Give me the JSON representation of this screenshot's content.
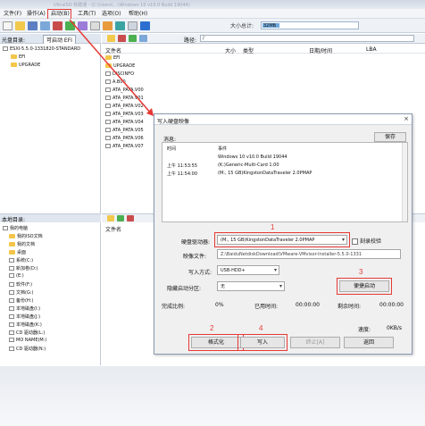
{
  "window": {
    "titlebar_text": "UltraISO 软碟通 - (C:\\Users\\...\\Windows 10 v10.0 Build 19044)"
  },
  "menu": {
    "items": [
      "文件(F)",
      "操作(A)",
      "启动(B)",
      "工具(T)",
      "选项(O)",
      "帮助(H)"
    ]
  },
  "toolbar": {
    "size_label": "大小总计:",
    "size_value": "32MB"
  },
  "left_panel": {
    "header_label": "光盘目录:",
    "bootable_label": "可启动 EFI",
    "tree": [
      "ESXI-5.5.0-1331820-STANDARD",
      "EFI",
      "UPGRADE"
    ]
  },
  "right_panel": {
    "path_label": "路径:",
    "path_value": "/",
    "columns": [
      "文件名",
      "大小",
      "类型",
      "日期/时间",
      "LBA"
    ],
    "files": [
      "EFI",
      "UPGRADE",
      "DISCINFO",
      "A.B00",
      "ATA_PATA.V00",
      "ATA_PATA.V01",
      "ATA_PATA.V02",
      "ATA_PATA.V03",
      "ATA_PATA.V04",
      "ATA_PATA.V05",
      "ATA_PATA.V06",
      "ATA_PATA.V07"
    ]
  },
  "local_panel": {
    "header_label": "本地目录:",
    "columns": [
      "文件名"
    ],
    "tree": [
      "我的电脑",
      "我的ISO文档",
      "我的文档",
      "桌面",
      "系统(C:)",
      "新加卷(D:)",
      "(E:)",
      "软件(F:)",
      "文档(G:)",
      "备份(H:)",
      "本地磁盘(I:)",
      "本地磁盘(J:)",
      "本地磁盘(K:)",
      "CD 驱动器(L:)",
      "MO NAME(M:)",
      "CD 驱动器(N:)"
    ]
  },
  "dialog": {
    "title": "写入硬盘映像",
    "close_glyph": "×",
    "message_label": "消息:",
    "save_label": "保存",
    "log_header": {
      "time": "时间",
      "event": "事件"
    },
    "log_rows": [
      {
        "time": "",
        "event": "Windows 10 v10.0 Build 19044"
      },
      {
        "time": "上午 11:53:55",
        "event": "(K:)Generic-Multi-Card        1.00"
      },
      {
        "time": "上午 11:54:00",
        "event": "(M:, 15 GB)KingstonDataTraveler 2.0PMAP"
      }
    ],
    "disk_label": "硬盘驱动器:",
    "disk_value": "(M:, 15 GB)KingstonDataTraveler 2.0PMAP",
    "verify_label": "刻录校验",
    "image_label": "映像文件:",
    "image_value": "Z:\\BaiduNetdiskDownload\\VMware-VMvisor-Installer-5.5.0-1331",
    "write_mode_label": "写入方式:",
    "write_mode_value": "USB-HDD+",
    "hidden_label": "隐藏启动分区:",
    "hidden_value": "无",
    "boot_btn": "便捷启动",
    "done_label": "完成比例:",
    "done_value": "0%",
    "elapsed_label": "已用时间:",
    "elapsed_value": "00:00:00",
    "remaining_label": "剩余时间:",
    "remaining_value": "00:00:00",
    "speed_label": "速度:",
    "speed_value": "0KB/s",
    "format_btn": "格式化",
    "write_btn": "写入",
    "stop_btn": "终止[A]",
    "back_btn": "返回"
  },
  "annotations": {
    "n1": "1",
    "n2": "2",
    "n3": "3",
    "n4": "4",
    "highlight_color": "#e53935"
  }
}
